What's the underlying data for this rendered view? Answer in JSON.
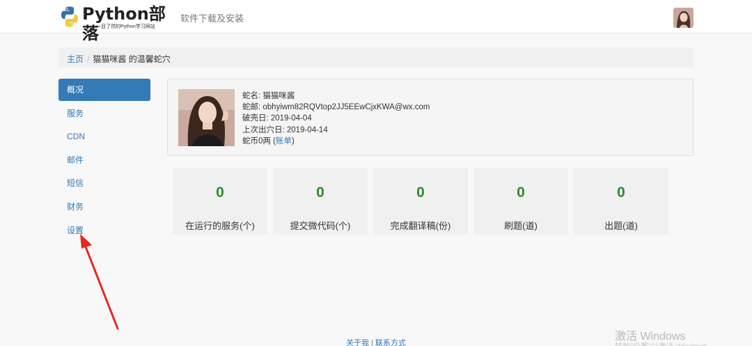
{
  "header": {
    "logo_title": "Python部落",
    "logo_subtitle": "一目了然的Python学习网站",
    "nav_link": "软件下载及安装"
  },
  "breadcrumb": {
    "home": "主页",
    "separator": "/",
    "current": "猫猫咪酱 的温馨蛇穴"
  },
  "sidebar": {
    "items": [
      {
        "label": "概况",
        "active": true
      },
      {
        "label": "服务"
      },
      {
        "label": "CDN"
      },
      {
        "label": "邮件"
      },
      {
        "label": "短信"
      },
      {
        "label": "财务"
      },
      {
        "label": "设置"
      }
    ]
  },
  "profile": {
    "name_line": "蛇名: 猫猫咪酱",
    "email_line": "蛇邮: obhyiwm82RQVtop2JJ5EEwCjxKWA@wx.com",
    "created_line": "破壳日: 2019-04-04",
    "last_out_line": "上次出穴日: 2019-04-14",
    "coins_prefix": "蛇币0两 (",
    "bill_link": "账单",
    "coins_suffix": ")"
  },
  "stats": [
    {
      "value": "0",
      "label": "在运行的服务(个)"
    },
    {
      "value": "0",
      "label": "提交微代码(个)"
    },
    {
      "value": "0",
      "label": "完成翻译稿(份)"
    },
    {
      "value": "0",
      "label": "刷题(道)"
    },
    {
      "value": "0",
      "label": "出题(道)"
    }
  ],
  "footer": {
    "about": "关于我",
    "separator": "|",
    "contact": "联系方式"
  },
  "watermark": {
    "line1": "激活 Windows",
    "line2": "转到\"设置\"以激活 Windows"
  },
  "colors": {
    "primary": "#337ab7",
    "stat_number": "#2e8b2e",
    "annotation_arrow": "#e8281c"
  }
}
